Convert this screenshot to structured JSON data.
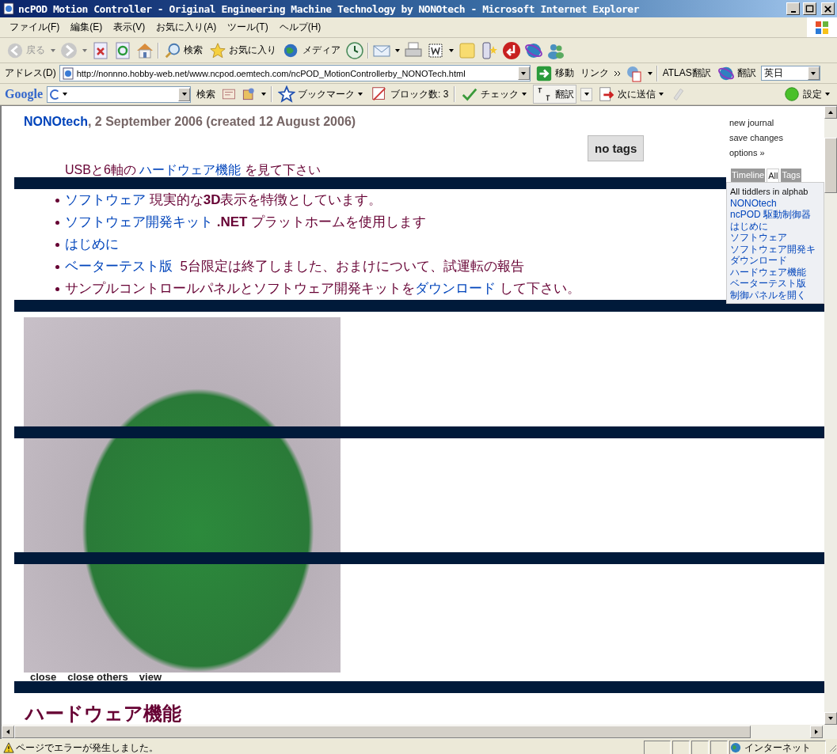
{
  "window": {
    "title": "ncPOD Motion Controller - Original Engineering Machine Technology by NONOtech - Microsoft Internet Explorer"
  },
  "menu": [
    "ファイル(F)",
    "編集(E)",
    "表示(V)",
    "お気に入り(A)",
    "ツール(T)",
    "ヘルプ(H)"
  ],
  "toolbar": {
    "back": {
      "label": "戻る",
      "disabled": true
    },
    "search": "検索",
    "favorites": "お気に入り",
    "media": "メディア"
  },
  "address": {
    "label": "アドレス(D)",
    "url": "http://nonnno.hobby-web.net/www.ncpod.oemtech.com/ncPOD_MotionControllerby_NONOTech.html",
    "go": "移動",
    "links": "リンク",
    "atlas": "ATLAS翻訳",
    "translate": "翻訳",
    "language": "英日"
  },
  "google_bar": {
    "logo": "Google",
    "search": "検索",
    "bookmarks": "ブックマーク",
    "blocked": "ブロック数: 3",
    "check": "チェック",
    "translate": "翻訳",
    "send": "次に送信",
    "settings": "設定"
  },
  "tiddler": {
    "author": "NONOtech",
    "date": ", 2 September 2006 (created 12 August 2006)",
    "tags_button": "no tags",
    "intro": [
      {
        "text": "USBと6軸の ",
        "link": false
      },
      {
        "text": "ハードウェア機能",
        "link": true
      },
      {
        "text": " を見て下さい",
        "link": false
      }
    ],
    "bullets": [
      [
        {
          "text": "ソフトウェア",
          "link": true
        },
        {
          "text": " 現実的な**3D**表示を特徴としています。",
          "link": false
        }
      ],
      [
        {
          "text": "ソフトウェア開発キット",
          "link": true
        },
        {
          "text": " **.NET** プラットホームを使用します",
          "link": false
        }
      ],
      [
        {
          "text": "はじめに",
          "link": true
        }
      ],
      [
        {
          "text": "ベーターテスト版",
          "link": true
        },
        {
          "text": "  5台限定は終了しました、おまけについて、試運転の報告",
          "link": false
        }
      ],
      [
        {
          "text": "サンプルコントロールパネルとソフトウェア開発キットを",
          "link": false
        },
        {
          "text": "ダウンロード",
          "link": true
        },
        {
          "text": " して下さい。",
          "link": false
        }
      ]
    ],
    "commands": [
      "close",
      "close others",
      "view"
    ]
  },
  "next_heading": "ハードウェア機能",
  "sidebar": {
    "commands": [
      "new journal",
      "save changes",
      "options »"
    ],
    "tabs": [
      {
        "label": "Timeline",
        "selected": false
      },
      {
        "label": "All",
        "selected": true
      },
      {
        "label": "Tags",
        "selected": false
      }
    ],
    "list_title": "All tiddlers in alphab",
    "items": [
      "NONOtech",
      "ncPOD 駆動制御器",
      "はじめに",
      "ソフトウェア",
      "ソフトウェア開発キ",
      "ダウンロード",
      "ハードウェア機能",
      "ベーターテスト版",
      "制御パネルを開く"
    ]
  },
  "status_bar": {
    "message": "ページでエラーが発生しました。",
    "zone": "インターネット"
  }
}
